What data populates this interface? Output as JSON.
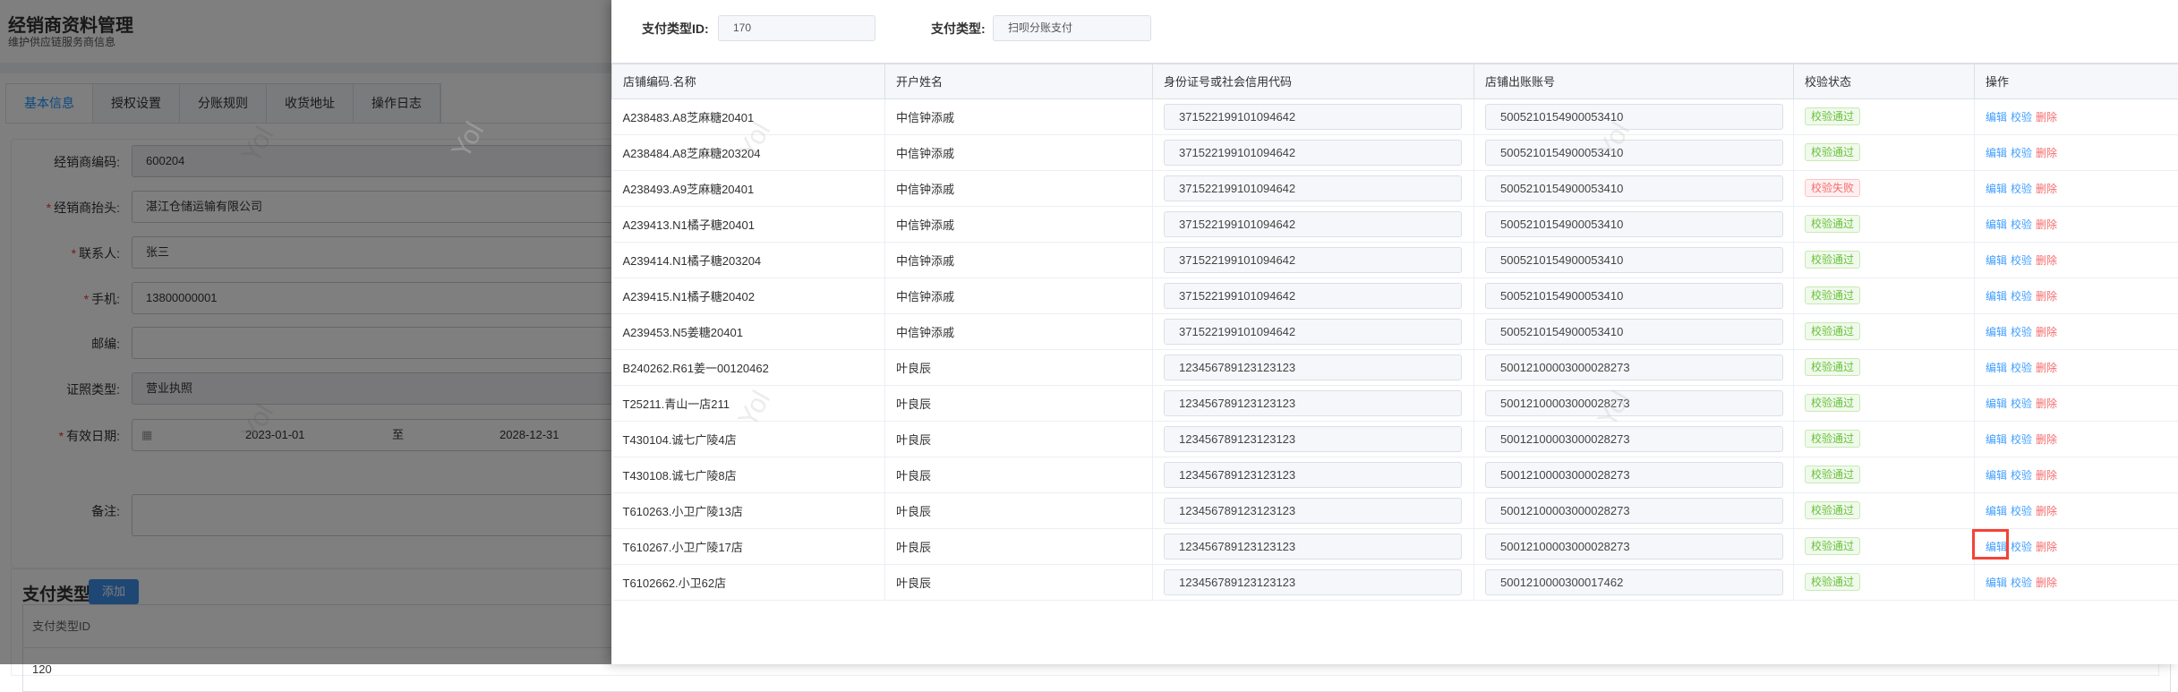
{
  "page": {
    "title": "经销商资料管理",
    "subtitle": "维护供应链服务商信息",
    "tabs": [
      "基本信息",
      "授权设置",
      "分账规则",
      "收货地址",
      "操作日志"
    ],
    "form": {
      "dealer_code": {
        "label": "经销商编码:",
        "value": "600204"
      },
      "dealer_header": {
        "label": "经销商抬头:",
        "value": "湛江仓储运输有限公司"
      },
      "contact": {
        "label": "联系人:",
        "value": "张三"
      },
      "phone": {
        "label": "手机:",
        "value": "13800000001"
      },
      "postcode": {
        "label": "邮编:",
        "value": ""
      },
      "license_type": {
        "label": "证照类型:",
        "value": "营业执照"
      },
      "valid_date": {
        "label": "有效日期:",
        "start": "2023-01-01",
        "separator": "至",
        "end": "2028-12-31"
      },
      "remark": {
        "label": "备注:",
        "value": ""
      }
    },
    "payment": {
      "title": "支付类型",
      "add_label": "添加",
      "column": "支付类型ID",
      "rows": [
        "120"
      ]
    },
    "watermark": "Yol"
  },
  "drawer": {
    "pay_type_id_label": "支付类型ID:",
    "pay_type_id": "170",
    "pay_type_label": "支付类型:",
    "pay_type": "扫呗分账支付",
    "columns": [
      "店铺编码.名称",
      "开户姓名",
      "身份证号或社会信用代码",
      "店铺出账账号",
      "校验状态",
      "操作"
    ],
    "actions": {
      "edit": "编辑",
      "verify": "校验",
      "delete": "删除"
    },
    "rows": [
      {
        "store": "A238483.A8芝麻糖20401",
        "name": "中信钟添戚",
        "id_code": "371522199101094642",
        "account": "5005210154900053410",
        "status": "校验通过",
        "ok": true
      },
      {
        "store": "A238484.A8芝麻糖203204",
        "name": "中信钟添戚",
        "id_code": "371522199101094642",
        "account": "5005210154900053410",
        "status": "校验通过",
        "ok": true
      },
      {
        "store": "A238493.A9芝麻糖20401",
        "name": "中信钟添戚",
        "id_code": "371522199101094642",
        "account": "5005210154900053410",
        "status": "校验失败",
        "ok": false
      },
      {
        "store": "A239413.N1橘子糖20401",
        "name": "中信钟添戚",
        "id_code": "371522199101094642",
        "account": "5005210154900053410",
        "status": "校验通过",
        "ok": true
      },
      {
        "store": "A239414.N1橘子糖203204",
        "name": "中信钟添戚",
        "id_code": "371522199101094642",
        "account": "5005210154900053410",
        "status": "校验通过",
        "ok": true
      },
      {
        "store": "A239415.N1橘子糖20402",
        "name": "中信钟添戚",
        "id_code": "371522199101094642",
        "account": "5005210154900053410",
        "status": "校验通过",
        "ok": true
      },
      {
        "store": "A239453.N5姜糖20401",
        "name": "中信钟添戚",
        "id_code": "371522199101094642",
        "account": "5005210154900053410",
        "status": "校验通过",
        "ok": true
      },
      {
        "store": "B240262.R61姜一00120462",
        "name": "叶良辰",
        "id_code": "123456789123123123",
        "account": "50012100003000028273",
        "status": "校验通过",
        "ok": true
      },
      {
        "store": "T25211.青山一店211",
        "name": "叶良辰",
        "id_code": "123456789123123123",
        "account": "50012100003000028273",
        "status": "校验通过",
        "ok": true
      },
      {
        "store": "T430104.诚七广陵4店",
        "name": "叶良辰",
        "id_code": "123456789123123123",
        "account": "50012100003000028273",
        "status": "校验通过",
        "ok": true
      },
      {
        "store": "T430108.诚七广陵8店",
        "name": "叶良辰",
        "id_code": "123456789123123123",
        "account": "50012100003000028273",
        "status": "校验通过",
        "ok": true
      },
      {
        "store": "T610263.小卫广陵13店",
        "name": "叶良辰",
        "id_code": "123456789123123123",
        "account": "50012100003000028273",
        "status": "校验通过",
        "ok": true
      },
      {
        "store": "T610267.小卫广陵17店",
        "name": "叶良辰",
        "id_code": "123456789123123123",
        "account": "50012100003000028273",
        "status": "校验通过",
        "ok": true
      },
      {
        "store": "T6102662.小卫62店",
        "name": "叶良辰",
        "id_code": "123456789123123123",
        "account": "5001210000300017462",
        "status": "校验通过",
        "ok": true
      }
    ],
    "colors": {
      "pass": "#67c23a",
      "fail": "#f56c6c",
      "link": "#409eff",
      "highlight": "#f44336"
    }
  }
}
